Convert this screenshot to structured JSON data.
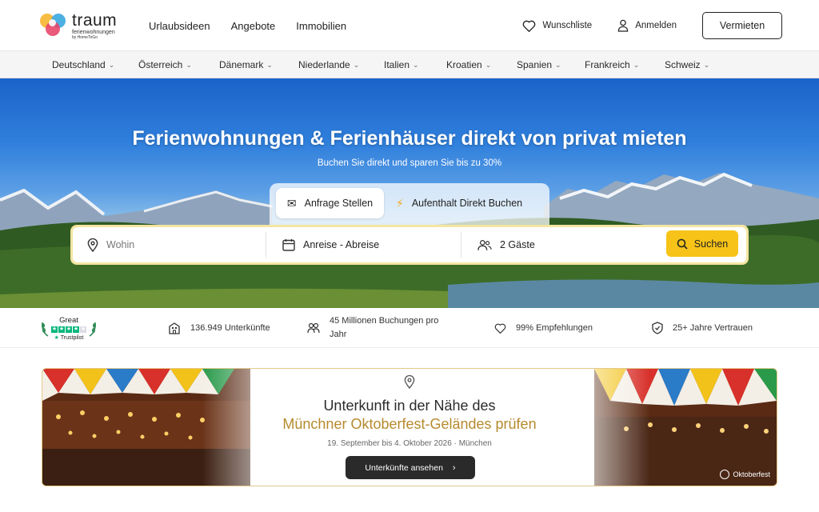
{
  "brand": {
    "name": "traum",
    "subtitle": "ferienwohnungen",
    "byline": "by HomeToGo"
  },
  "nav": {
    "links": [
      "Urlaubsideen",
      "Angebote",
      "Immobilien"
    ],
    "wishlist": "Wunschliste",
    "login": "Anmelden",
    "rent_out": "Vermieten"
  },
  "countries": [
    "Deutschland",
    "Österreich",
    "Dänemark",
    "Niederlande",
    "Italien",
    "Kroatien",
    "Spanien",
    "Frankreich",
    "Schweiz"
  ],
  "hero": {
    "title": "Ferienwohnungen & Ferienhäuser direkt von privat mieten",
    "subtitle": "Buchen Sie direkt und sparen Sie bis zu 30%",
    "tabs": [
      {
        "label": "Anfrage Stellen",
        "icon": "envelope-icon",
        "active": true
      },
      {
        "label": "Aufenthalt Direkt Buchen",
        "icon": "lightning-icon",
        "active": false
      }
    ],
    "search": {
      "destination_placeholder": "Wohin",
      "dates_placeholder": "Anreise - Abreise",
      "guests": "2 Gäste",
      "button": "Suchen"
    }
  },
  "trustpilot": {
    "rating": "Great",
    "brand": "Trustpilot",
    "stars": 4
  },
  "stats": [
    {
      "icon": "building-icon",
      "text": "136.949 Unterkünfte"
    },
    {
      "icon": "people-icon",
      "text": "45 Millionen Buchungen pro Jahr"
    },
    {
      "icon": "heart-icon",
      "text": "99% Empfehlungen"
    },
    {
      "icon": "shield-icon",
      "text": "25+ Jahre Vertrauen"
    }
  ],
  "banner": {
    "title_line1": "Unterkunft in der Nähe des",
    "title_line2": "Münchner Oktoberfest-Geländes prüfen",
    "date": "19. September bis 4. Oktober 2026 · München",
    "button": "Unterkünfte ansehen",
    "watermark": "Oktoberfest"
  },
  "colors": {
    "accent_yellow": "#f7c318",
    "search_border": "#f3e5a2",
    "banner_gold": "#b58a2e",
    "trustpilot_green": "#00b67a"
  }
}
